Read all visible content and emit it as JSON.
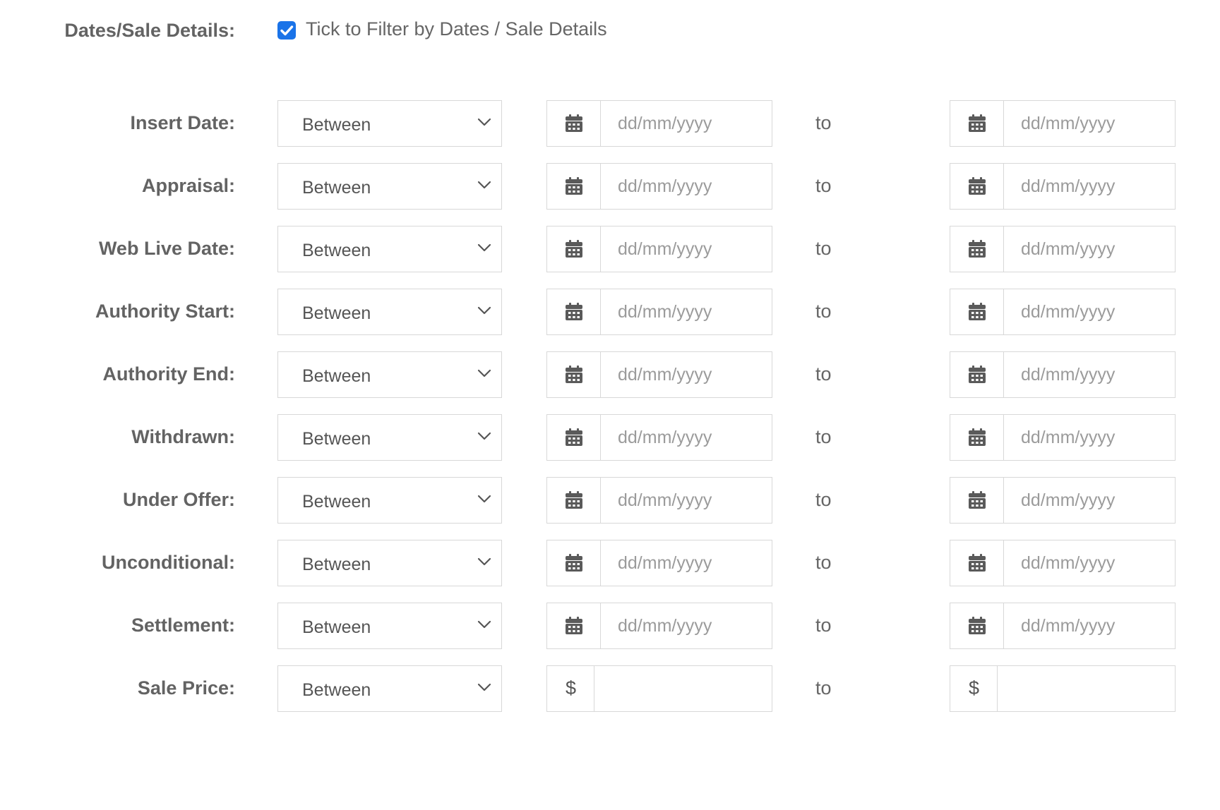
{
  "header": {
    "label": "Dates/Sale Details:",
    "checkbox_checked": true,
    "checkbox_label": "Tick to Filter by Dates / Sale Details",
    "accent_color": "#1a73e8"
  },
  "rows": [
    {
      "label": "Insert Date:",
      "operator": "Between",
      "type": "date",
      "from_placeholder": "dd/mm/yyyy",
      "to_text": "to",
      "to_placeholder": "dd/mm/yyyy",
      "icon": "calendar-icon"
    },
    {
      "label": "Appraisal:",
      "operator": "Between",
      "type": "date",
      "from_placeholder": "dd/mm/yyyy",
      "to_text": "to",
      "to_placeholder": "dd/mm/yyyy",
      "icon": "calendar-icon"
    },
    {
      "label": "Web Live Date:",
      "operator": "Between",
      "type": "date",
      "from_placeholder": "dd/mm/yyyy",
      "to_text": "to",
      "to_placeholder": "dd/mm/yyyy",
      "icon": "calendar-icon"
    },
    {
      "label": "Authority Start:",
      "operator": "Between",
      "type": "date",
      "from_placeholder": "dd/mm/yyyy",
      "to_text": "to",
      "to_placeholder": "dd/mm/yyyy",
      "icon": "calendar-icon"
    },
    {
      "label": "Authority End:",
      "operator": "Between",
      "type": "date",
      "from_placeholder": "dd/mm/yyyy",
      "to_text": "to",
      "to_placeholder": "dd/mm/yyyy",
      "icon": "calendar-icon"
    },
    {
      "label": "Withdrawn:",
      "operator": "Between",
      "type": "date",
      "from_placeholder": "dd/mm/yyyy",
      "to_text": "to",
      "to_placeholder": "dd/mm/yyyy",
      "icon": "calendar-icon"
    },
    {
      "label": "Under Offer:",
      "operator": "Between",
      "type": "date",
      "from_placeholder": "dd/mm/yyyy",
      "to_text": "to",
      "to_placeholder": "dd/mm/yyyy",
      "icon": "calendar-icon"
    },
    {
      "label": "Unconditional:",
      "operator": "Between",
      "type": "date",
      "from_placeholder": "dd/mm/yyyy",
      "to_text": "to",
      "to_placeholder": "dd/mm/yyyy",
      "icon": "calendar-icon"
    },
    {
      "label": "Settlement:",
      "operator": "Between",
      "type": "date",
      "from_placeholder": "dd/mm/yyyy",
      "to_text": "to",
      "to_placeholder": "dd/mm/yyyy",
      "icon": "calendar-icon"
    },
    {
      "label": "Sale Price:",
      "operator": "Between",
      "type": "money",
      "currency": "$",
      "to_text": "to",
      "icon": "dollar-icon"
    }
  ]
}
